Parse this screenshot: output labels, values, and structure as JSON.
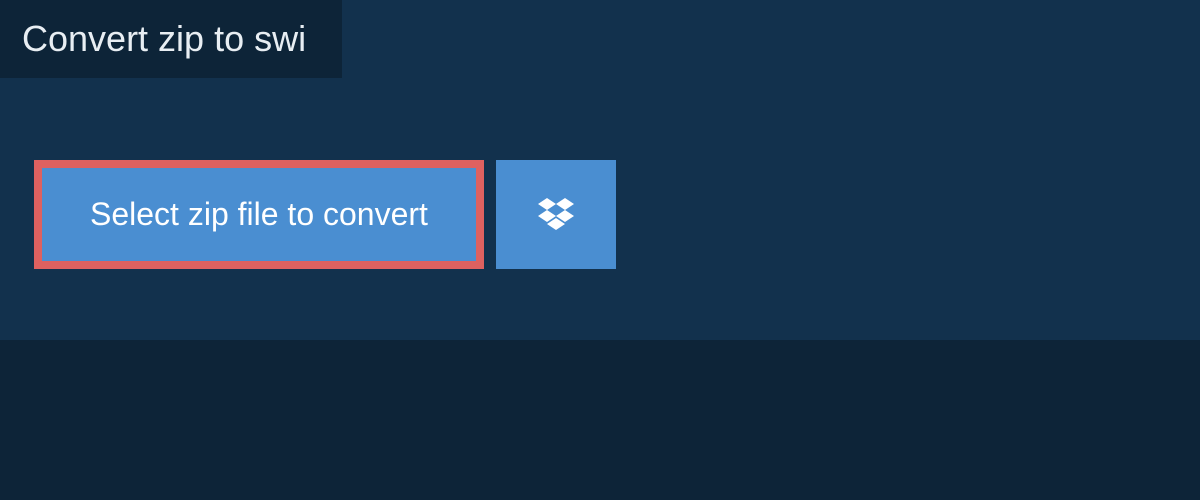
{
  "tab": {
    "title": "Convert zip to swi"
  },
  "buttons": {
    "select_label": "Select zip file to convert"
  },
  "colors": {
    "background": "#0d2438",
    "panel": "#12314d",
    "button_bg": "#4a8ed1",
    "button_border": "#de6160",
    "text_light": "#ffffff"
  }
}
